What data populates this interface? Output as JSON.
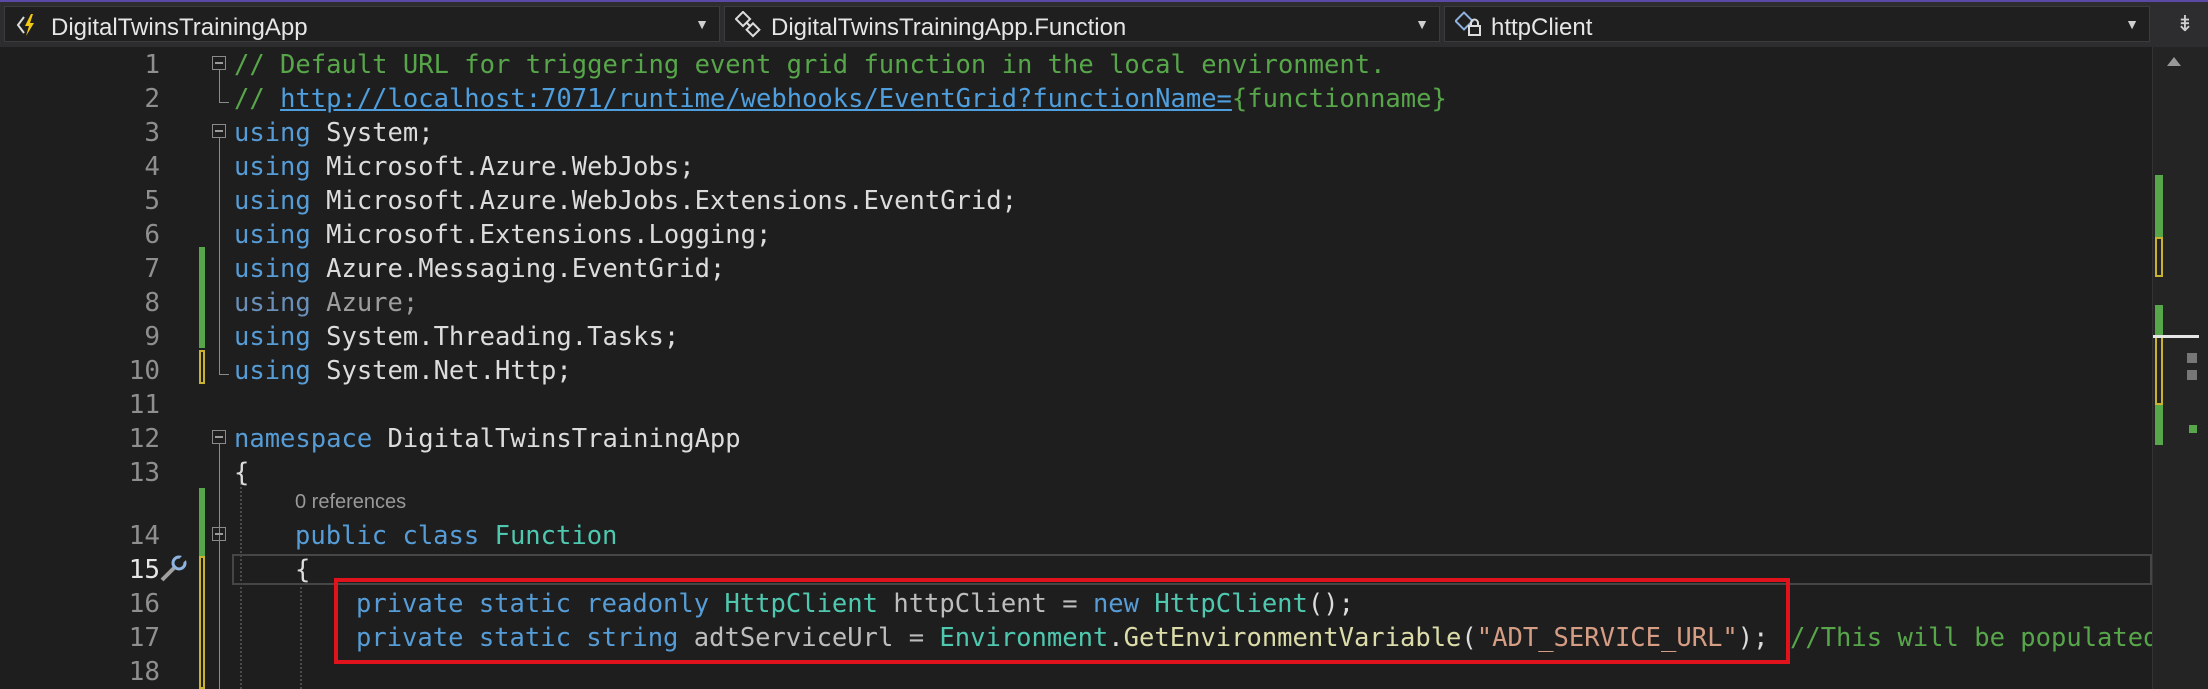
{
  "navbar": {
    "project": "DigitalTwinsTrainingApp",
    "type": "DigitalTwinsTrainingApp.Function",
    "member": "httpClient",
    "icons": {
      "project": "azure-function-icon",
      "type": "class-icon",
      "member": "private-field-icon"
    }
  },
  "editor": {
    "line_numbers": [
      "1",
      "2",
      "3",
      "4",
      "5",
      "6",
      "7",
      "8",
      "9",
      "10",
      "11",
      "12",
      "13",
      "14",
      "15",
      "16",
      "17",
      "18"
    ],
    "current_line": "15",
    "codelens": "0 references",
    "lines": {
      "l1_comment": "// Default URL for triggering event grid function in the local environment.",
      "l2_comment_prefix": "// ",
      "l2_url": "http://localhost:7071/runtime/webhooks/EventGrid?functionName=",
      "l2_suffix": "{functionname}",
      "using_kw": "using",
      "l3_ns": " System;",
      "l4_ns": " Microsoft.Azure.WebJobs;",
      "l5_ns": " Microsoft.Azure.WebJobs.Extensions.EventGrid;",
      "l6_ns": " Microsoft.Extensions.Logging;",
      "l7_ns": " Azure.Messaging.EventGrid;",
      "l8_ns": " Azure;",
      "l9_ns": " System.Threading.Tasks;",
      "l10_ns": " System.Net.Http;",
      "l12_kw": "namespace",
      "l12_name": " DigitalTwinsTrainingApp",
      "l13_brace": "{",
      "l14_mod": "public class",
      "l14_name": " Function",
      "l15_brace": "{",
      "l16_mod": "private static readonly",
      "l16_type": "HttpClient",
      "l16_field": " httpClient = ",
      "l16_new": "new",
      "l16_ctor": "HttpClient",
      "l16_end": "();",
      "l17_mod": "private static string",
      "l17_field": " adtServiceUrl = ",
      "l17_env": "Environment",
      "l17_dot": ".",
      "l17_fn": "GetEnvironmentVariable",
      "l17_open": "(",
      "l17_str": "\"ADT_SERVICE_URL\"",
      "l17_close": ");",
      "l17_comment": "//This will be populated"
    }
  },
  "colors": {
    "comment": "#57a64a",
    "keyword": "#569cd6",
    "type": "#4ec9b0",
    "string": "#d69d85",
    "method": "#dcdcaa",
    "highlight": "#e0121c"
  }
}
